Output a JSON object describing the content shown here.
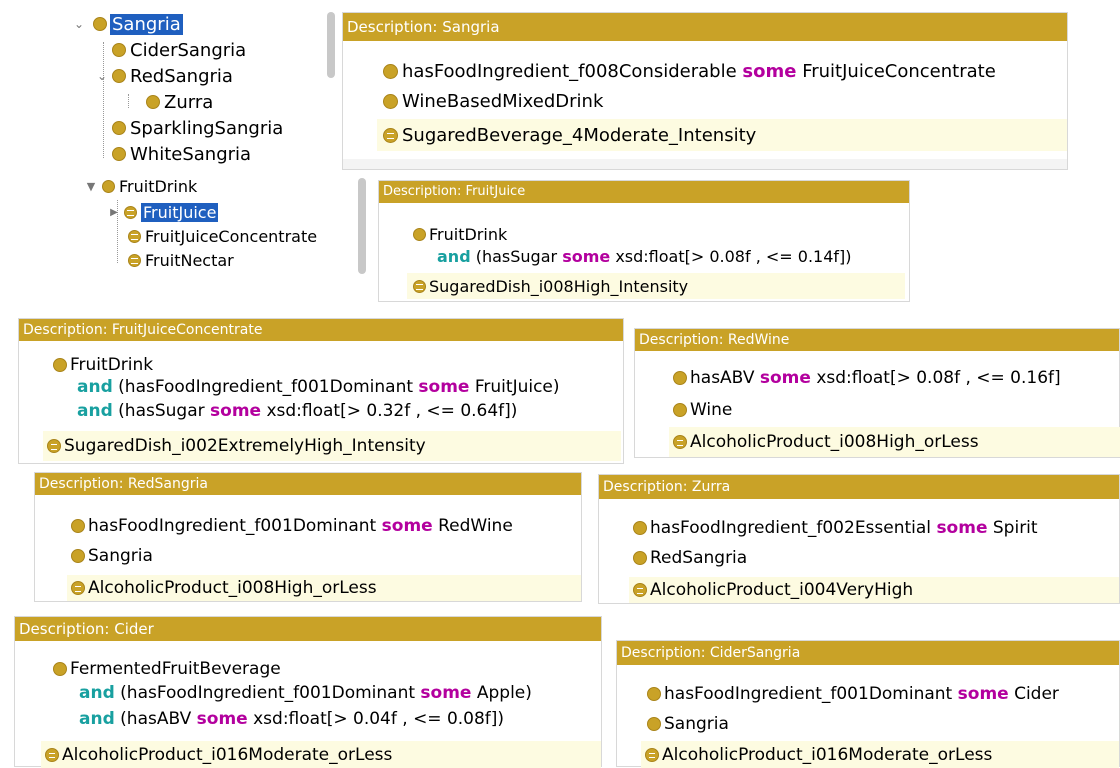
{
  "tree1": {
    "root": "Sangria",
    "children": [
      "CiderSangria",
      "RedSangria",
      "Zurra",
      "SparklingSangria",
      "WhiteSangria"
    ]
  },
  "tree2": {
    "root": "FruitDrink",
    "children": [
      "FruitJuice",
      "FruitJuiceConcentrate",
      "FruitNectar"
    ]
  },
  "panels": {
    "sangria": {
      "title": "Description: Sangria",
      "rows": [
        "hasFoodIngredient_f008Considerable",
        "some",
        "FruitJuiceConcentrate",
        "WineBasedMixedDrink",
        "SugaredBeverage_4Moderate_Intensity"
      ]
    },
    "fruitjuice": {
      "title": "Description: FruitJuice",
      "rows": [
        "FruitDrink",
        "and",
        "(hasSugar",
        "some",
        "xsd:float[> 0.08f , <= 0.14f])",
        "SugaredDish_i008High_Intensity"
      ]
    },
    "fjc": {
      "title": "Description: FruitJuiceConcentrate",
      "rows": [
        "FruitDrink",
        "and",
        "(hasFoodIngredient_f001Dominant",
        "some",
        "FruitJuice)",
        "and",
        "(hasSugar",
        "some",
        "xsd:float[> 0.32f , <= 0.64f])",
        "SugaredDish_i002ExtremelyHigh_Intensity"
      ]
    },
    "redwine": {
      "title": "Description: RedWine",
      "rows": [
        "hasABV",
        "some",
        "xsd:float[> 0.08f , <= 0.16f]",
        "Wine",
        "AlcoholicProduct_i008High_orLess"
      ]
    },
    "redsangria": {
      "title": "Description: RedSangria",
      "rows": [
        "hasFoodIngredient_f001Dominant",
        "some",
        "RedWine",
        "Sangria",
        "AlcoholicProduct_i008High_orLess"
      ]
    },
    "zurra": {
      "title": "Description: Zurra",
      "rows": [
        "hasFoodIngredient_f002Essential",
        "some",
        "Spirit",
        "RedSangria",
        "AlcoholicProduct_i004VeryHigh"
      ]
    },
    "cider": {
      "title": "Description: Cider",
      "rows": [
        "FermentedFruitBeverage",
        "and",
        "(hasFoodIngredient_f001Dominant",
        "some",
        "Apple)",
        "and",
        "(hasABV",
        "some",
        "xsd:float[> 0.04f , <= 0.08f])",
        "AlcoholicProduct_i016Moderate_orLess"
      ]
    },
    "cidersangria": {
      "title": "Description: CiderSangria",
      "rows": [
        "hasFoodIngredient_f001Dominant",
        "some",
        "Cider",
        "Sangria",
        "AlcoholicProduct_i016Moderate_orLess"
      ]
    }
  },
  "colors": {
    "header_gold": "#c9a227",
    "class_dot": "#c9a227",
    "selection_blue": "#1f5fbf",
    "keyword_some": "#b3009e",
    "keyword_and": "#18a0a0",
    "inferred_row": "#fdfbe1"
  },
  "icons": [
    "class-icon",
    "equivalent-class-icon",
    "expand-arrow-icon",
    "collapse-arrow-icon"
  ]
}
